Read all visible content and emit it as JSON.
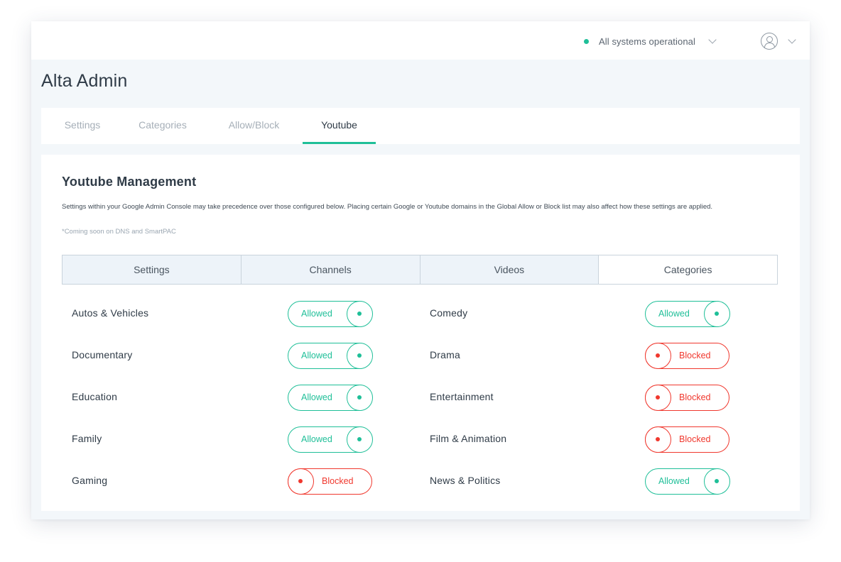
{
  "topbar": {
    "status_text": "All systems operational",
    "status_color": "#1fbf98",
    "status_chevron_icon": "chevron-down-icon",
    "user_icon": "user-circle-icon",
    "user_chevron_icon": "chevron-down-icon"
  },
  "page": {
    "title": "Alta Admin"
  },
  "tabs": [
    {
      "label": "Settings",
      "active": false
    },
    {
      "label": "Categories",
      "active": false
    },
    {
      "label": "Allow/Block",
      "active": false
    },
    {
      "label": "Youtube",
      "active": true
    }
  ],
  "youtube": {
    "title": "Youtube Management",
    "description": "Settings within your Google Admin Console may take precedence over those configured below. Placing certain Google or Youtube domains in the Global Allow or Block list may also affect how these settings are applied.",
    "note": "*Coming soon on DNS and SmartPAC",
    "subtabs": [
      {
        "label": "Settings",
        "active": false
      },
      {
        "label": "Channels",
        "active": false
      },
      {
        "label": "Videos",
        "active": false
      },
      {
        "label": "Categories",
        "active": true
      }
    ],
    "categories_left": [
      {
        "label": "Autos & Vehicles",
        "state": "Allowed"
      },
      {
        "label": "Documentary",
        "state": "Allowed"
      },
      {
        "label": "Education",
        "state": "Allowed"
      },
      {
        "label": "Family",
        "state": "Allowed"
      },
      {
        "label": "Gaming",
        "state": "Blocked"
      }
    ],
    "categories_right": [
      {
        "label": "Comedy",
        "state": "Allowed"
      },
      {
        "label": "Drama",
        "state": "Blocked"
      },
      {
        "label": "Entertainment",
        "state": "Blocked"
      },
      {
        "label": "Film & Animation",
        "state": "Blocked"
      },
      {
        "label": "News & Politics",
        "state": "Allowed"
      }
    ]
  },
  "colors": {
    "accent": "#1fbf98",
    "blocked": "#f0382e",
    "background": "#f3f7fa",
    "text": "#2f3b47"
  }
}
